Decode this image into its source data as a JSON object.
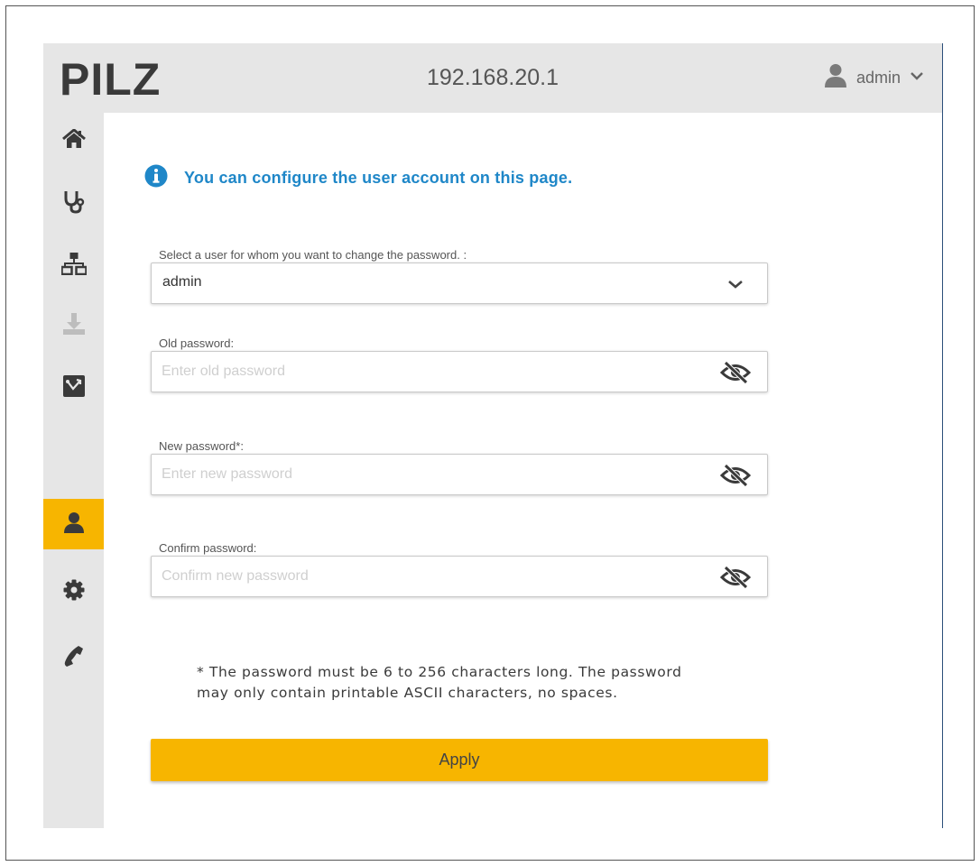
{
  "header": {
    "logo": "PILZ",
    "host": "192.168.20.1",
    "user_name": "admin"
  },
  "sidebar": {
    "items": [
      {
        "name": "home",
        "icon": "home-icon"
      },
      {
        "name": "diagnostics",
        "icon": "stethoscope-icon"
      },
      {
        "name": "network",
        "icon": "network-icon"
      },
      {
        "name": "download",
        "icon": "download-icon"
      },
      {
        "name": "topology",
        "icon": "topology-icon"
      },
      {
        "name": "user",
        "icon": "user-icon",
        "active": true
      },
      {
        "name": "settings",
        "icon": "gear-icon"
      },
      {
        "name": "contact",
        "icon": "phone-icon"
      }
    ]
  },
  "info": {
    "text": "You can configure the user account on this page."
  },
  "form": {
    "user_select": {
      "label": "Select a user for whom you want to change the password. :",
      "value": "admin"
    },
    "old_password": {
      "label": "Old password:",
      "placeholder": "Enter old password"
    },
    "new_password": {
      "label": "New password*:",
      "placeholder": "Enter new password"
    },
    "confirm_password": {
      "label": "Confirm password:",
      "placeholder": "Confirm new password"
    },
    "note": "* The password must be 6 to 256 characters long. The password\nmay only contain printable ASCII characters, no spaces.",
    "apply_label": "Apply"
  },
  "colors": {
    "accent": "#f7b500",
    "info": "#1f87c8",
    "sidebar_bg": "#e6e6e6"
  }
}
